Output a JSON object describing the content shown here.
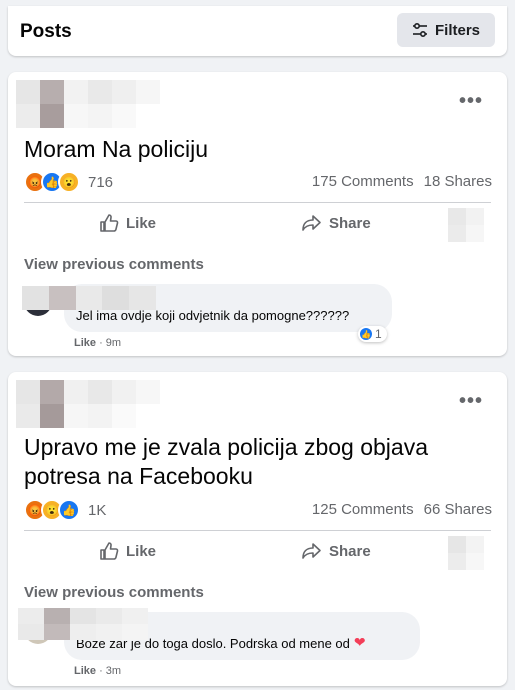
{
  "header": {
    "title": "Posts",
    "filters_label": "Filters"
  },
  "posts": [
    {
      "text": "Moram Na policiju",
      "reaction_count": "716",
      "comments": "175 Comments",
      "shares": "18 Shares",
      "like_label": "Like",
      "share_label": "Share",
      "view_prev": "View previous comments",
      "comment_text": "Jel ima ovdje koji odvjetnik da pomogne??????",
      "comment_like": "Like",
      "comment_time": " · 9m",
      "comment_react_count": "1",
      "reactions": [
        "angry",
        "like",
        "wow"
      ]
    },
    {
      "text": "Upravo me je zvala policija zbog objava potresa na Facebooku",
      "reaction_count": "1K",
      "comments": "125 Comments",
      "shares": "66 Shares",
      "like_label": "Like",
      "share_label": "Share",
      "view_prev": "View previous comments",
      "comment_text": "Boze zar je do toga doslo. Podrska od mene od",
      "comment_like": "Like",
      "comment_time": " · 3m",
      "reactions": [
        "angry",
        "wow",
        "like"
      ]
    }
  ],
  "colors": {
    "like_blue": "#1877f2",
    "angry": "#e9710f",
    "wow": "#f7b125",
    "heart": "#f33e58"
  }
}
